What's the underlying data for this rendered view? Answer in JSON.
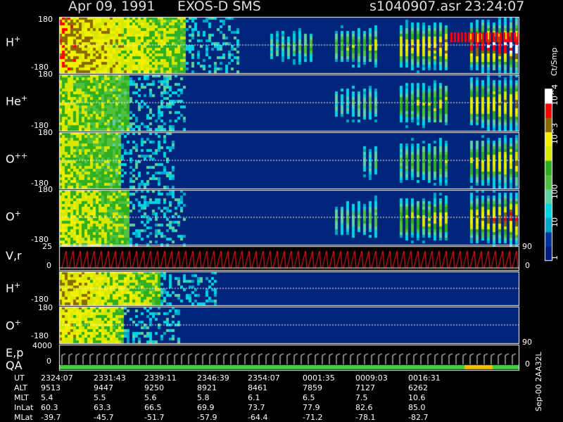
{
  "header": {
    "date": "Apr 09, 1991",
    "mission": "EXOS-D SMS",
    "file": "s1040907.asr",
    "time": "23:24:07"
  },
  "panels": [
    {
      "species": "H",
      "charge": "+",
      "ymax": "180",
      "ymin": "-180"
    },
    {
      "species": "He",
      "charge": "+",
      "ymax": "180",
      "ymin": "-180"
    },
    {
      "species": "O",
      "charge": "++",
      "ymax": "180",
      "ymin": "-180"
    },
    {
      "species": "O",
      "charge": "+",
      "ymax": "180",
      "ymin": "-180"
    },
    {
      "species": "V,r",
      "charge": "",
      "ymax": "25",
      "ymin": "0",
      "right_top": "90",
      "right_bottom": "0"
    },
    {
      "species": "H",
      "charge": "+",
      "ymax": "180",
      "ymin": "-180"
    },
    {
      "species": "O",
      "charge": "+",
      "ymax": "180",
      "ymin": "-180"
    },
    {
      "species": "E,p",
      "charge": "",
      "ymax": "4000",
      "ymin": "0",
      "right_top": "90"
    },
    {
      "species": "QA",
      "charge": "",
      "ymax": "",
      "ymin": "",
      "right_bottom": "0"
    }
  ],
  "colorbar": {
    "title": "Ct/Smp",
    "ticks": [
      "10^4",
      "10^3",
      "100",
      "10",
      "1"
    ]
  },
  "footer": {
    "rows": [
      {
        "label": "UT",
        "values": [
          "2324:07",
          "2331:43",
          "2339:11",
          "2346:39",
          "2354:07",
          "0001:35",
          "0009:03",
          "0016:31"
        ]
      },
      {
        "label": "ALT",
        "values": [
          "9513",
          "9447",
          "9250",
          "8921",
          "8461",
          "7859",
          "7127",
          "6262"
        ]
      },
      {
        "label": "MLT",
        "values": [
          "5.4",
          "5.5",
          "5.6",
          "5.8",
          "6.1",
          "6.5",
          "7.5",
          "10.6"
        ]
      },
      {
        "label": "InLat",
        "values": [
          "60.3",
          "63.3",
          "66.5",
          "69.9",
          "73.7",
          "77.9",
          "82.6",
          "85.0"
        ]
      },
      {
        "label": "MLat",
        "values": [
          "-39.7",
          "-45.7",
          "-51.7",
          "-57.9",
          "-64.4",
          "-71.2",
          "-78.1",
          "-82.7"
        ]
      }
    ],
    "stamp": "Sep-00 2AA32L"
  },
  "chart_data": {
    "type": "heatmap",
    "title": "Apr 09, 1991   EXOS-D SMS",
    "colorscale_label": "Ct/Smp",
    "colorscale_range": [
      1,
      10000
    ],
    "colorscale_log": true,
    "x_ticks_ut": [
      "2324:07",
      "2331:43",
      "2339:11",
      "2346:39",
      "2354:07",
      "0001:35",
      "0009:03",
      "0016:31"
    ],
    "panels": [
      {
        "label": "H+",
        "ylim": [
          -180,
          180
        ],
        "kind": "pitch-angle spectrogram"
      },
      {
        "label": "He+",
        "ylim": [
          -180,
          180
        ],
        "kind": "pitch-angle spectrogram"
      },
      {
        "label": "O++",
        "ylim": [
          -180,
          180
        ],
        "kind": "pitch-angle spectrogram"
      },
      {
        "label": "O+",
        "ylim": [
          -180,
          180
        ],
        "kind": "pitch-angle spectrogram"
      },
      {
        "label": "V,r",
        "ylim": [
          0,
          25
        ],
        "right_ylim": [
          0,
          90
        ],
        "kind": "line"
      },
      {
        "label": "H+",
        "ylim": [
          -180,
          180
        ],
        "kind": "pitch-angle spectrogram"
      },
      {
        "label": "O+",
        "ylim": [
          -180,
          180
        ],
        "kind": "pitch-angle spectrogram"
      },
      {
        "label": "E,p",
        "ylim": [
          0,
          4000
        ],
        "right_ylim": [
          0,
          90
        ],
        "kind": "line"
      },
      {
        "label": "QA",
        "kind": "quality flag"
      }
    ]
  }
}
